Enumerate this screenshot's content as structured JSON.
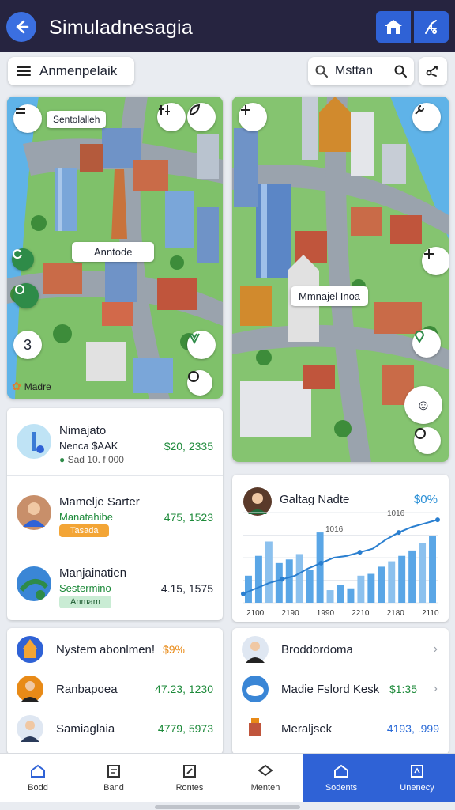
{
  "header": {
    "title": "Simuladnesagia",
    "back_icon": "arrow-left-icon",
    "actions": [
      {
        "icon": "house-icon"
      },
      {
        "icon": "settings-icon"
      }
    ]
  },
  "toolbar": {
    "menu_label": "Anmenpelaik",
    "search_value": "Msttan",
    "share_icon": "share-icon"
  },
  "map_left": {
    "top_label": "Sentolalleh",
    "center_label": "Anntode",
    "caption": "Madre",
    "button_left_3": "3"
  },
  "map_right": {
    "center_label": "Mmnajel Inoa"
  },
  "list_card": {
    "rows": [
      {
        "name": "Nimajato",
        "sub": "Nenca $AAK",
        "meta": "Sad 10. f 000",
        "value": "$20, 2335",
        "sub_color": "#1a1f2b",
        "val_color": "#1d8a3a"
      },
      {
        "name": "Mamelje Sarter",
        "sub": "Manatahibe",
        "tag": "Tasada",
        "tag_bg": "#f3a536",
        "value": "475, 1523",
        "sub_color": "#1d8a3a",
        "val_color": "#1d8a3a"
      },
      {
        "name": "Manjainatien",
        "sub": "Sestermino",
        "tag": "Anmam",
        "tag_bg": "#c9ecd4",
        "value": "4.15, 1575",
        "sub_color": "#1d8a3a",
        "val_color": "#1d8a3a"
      }
    ]
  },
  "chart_card": {
    "title": "Galtag Nadte",
    "percent": "$0%"
  },
  "chart_data": {
    "type": "bar",
    "categories": [
      "2100",
      "2190",
      "1990",
      "2210",
      "2180",
      "2110"
    ],
    "values": [
      30,
      52,
      68,
      44,
      48,
      54,
      36,
      78,
      14,
      20,
      16,
      30,
      32,
      40,
      46,
      52,
      58,
      66,
      74
    ],
    "line": [
      10,
      16,
      22,
      26,
      30,
      38,
      44,
      50,
      52,
      56,
      60,
      70,
      78,
      84,
      88,
      92
    ],
    "top_labels": [
      "1016",
      "1016"
    ],
    "ylim": [
      0,
      100
    ]
  },
  "list2_left": {
    "rows": [
      {
        "name": "Nystem abonlmen!",
        "value": "$9%",
        "val_color": "#e88a17"
      },
      {
        "name": "Ranbapoea",
        "value": "47.23, 1230",
        "val_color": "#1d8a3a"
      },
      {
        "name": "Samiaglaia",
        "value": "4779, 5973",
        "val_color": "#1d8a3a"
      }
    ]
  },
  "list2_right": {
    "rows": [
      {
        "name": "Broddordoma",
        "value": ""
      },
      {
        "name": "Madie Fslord Kesk",
        "value": "$1:35",
        "val_color": "#1d8a3a"
      },
      {
        "name": "Meraljsek",
        "value": "4193, .999",
        "val_color": "#2a6ad6"
      }
    ]
  },
  "bottom_nav": {
    "items": [
      {
        "label": "Bodd",
        "icon": "home-icon"
      },
      {
        "label": "Band",
        "icon": "clipboard-icon"
      },
      {
        "label": "Rontes",
        "icon": "edit-icon"
      },
      {
        "label": "Menten",
        "icon": "layers-icon"
      },
      {
        "label": "Sodents",
        "icon": "house-outline-icon"
      },
      {
        "label": "Unenecy",
        "icon": "panel-icon"
      }
    ]
  },
  "colors": {
    "header_bg": "#262440",
    "accent": "#2f62d6",
    "green": "#1d8a3a"
  }
}
